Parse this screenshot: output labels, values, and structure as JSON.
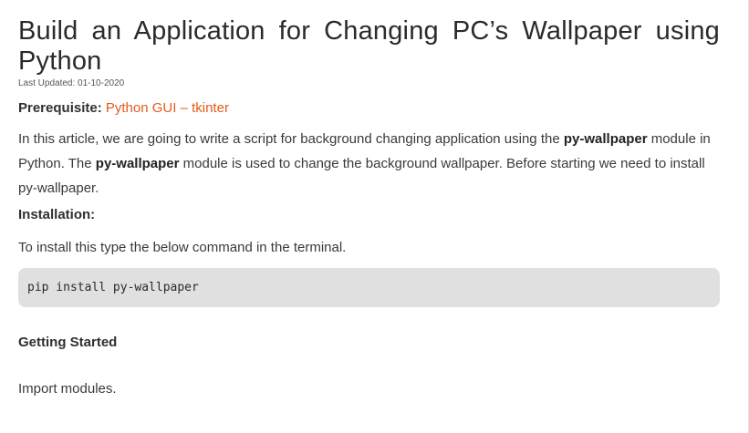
{
  "article": {
    "title": "Build an Application for Changing PC’s Wallpaper using Python",
    "last_updated": "Last Updated: 01-10-2020",
    "prerequisite_label": "Prerequisite:",
    "prerequisite_link": "Python GUI – tkinter",
    "intro": {
      "t1": "In this article, we are going to write a script for background changing application using the ",
      "b1": "py-wallpaper",
      "t2": " module in Python. The ",
      "b2": "py-wallpaper",
      "t3": " module is used to change the background wallpaper.  Before starting we need to install py-wallpaper."
    },
    "installation_heading": "Installation:",
    "installation_text": "To install this type the below command in the terminal.",
    "install_command": "pip install py-wallpaper",
    "getting_started_heading": "Getting Started",
    "import_text": "Import modules."
  },
  "colors": {
    "link": "#e35b1d",
    "code_background": "#e0e0e0",
    "text": "#303030"
  }
}
